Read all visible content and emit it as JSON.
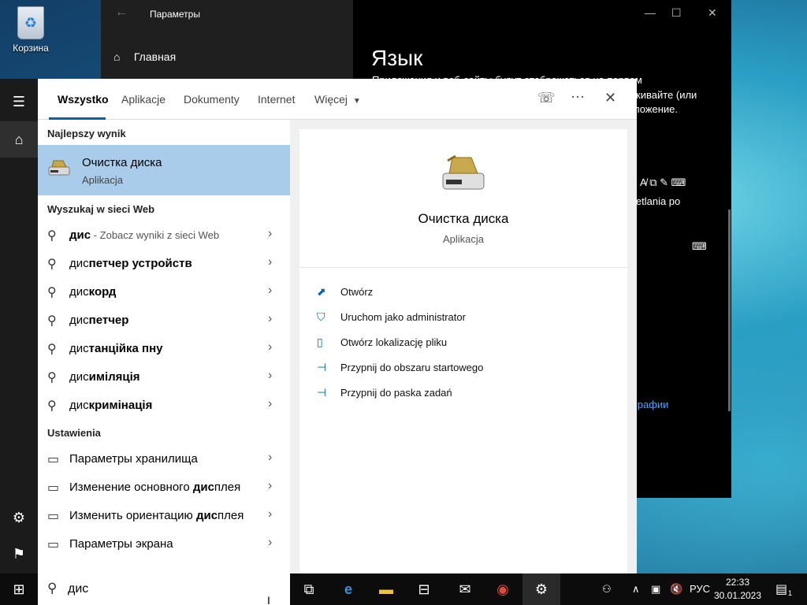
{
  "desktop": {
    "recycle_bin_label": "Корзина"
  },
  "settings_window": {
    "title": "Параметры",
    "home_label": "Главная",
    "heading": "Язык",
    "partial_lines": [
      "Приложения и веб-сайты будут отображаться на первом",
      "живайте (или",
      "ложение."
    ],
    "partial_side": "ietlania po",
    "partial_link": "графии"
  },
  "search": {
    "tabs": [
      {
        "label": "Wszystko",
        "active": true
      },
      {
        "label": "Aplikacje"
      },
      {
        "label": "Dokumenty"
      },
      {
        "label": "Internet"
      },
      {
        "label": "Więcej"
      }
    ],
    "best_match_header": "Najlepszy wynik",
    "best_match": {
      "name": "Очистка диска",
      "type": "Aplikacja"
    },
    "web_header": "Wyszukaj w sieci Web",
    "web_results": [
      {
        "prefix": "дис",
        "rest": "",
        "suffix": " - Zobacz wyniki z sieci Web"
      },
      {
        "prefix": "дис",
        "rest": "петчер устройств",
        "suffix": ""
      },
      {
        "prefix": "дис",
        "rest": "корд",
        "suffix": ""
      },
      {
        "prefix": "дис",
        "rest": "петчер",
        "suffix": ""
      },
      {
        "prefix": "дис",
        "rest": "танційка пну",
        "suffix": ""
      },
      {
        "prefix": "дис",
        "rest": "иміляція",
        "suffix": ""
      },
      {
        "prefix": "дис",
        "rest": "кримінація",
        "suffix": ""
      }
    ],
    "settings_header": "Ustawienia",
    "settings_results": [
      {
        "pre": "Параметры хранилища",
        "bold": "",
        "post": ""
      },
      {
        "pre": "Изменение основного ",
        "bold": "дис",
        "post": "плея"
      },
      {
        "pre": "Изменить ориентацию ",
        "bold": "дис",
        "post": "плея"
      },
      {
        "pre": "Параметры экрана",
        "bold": "",
        "post": ""
      }
    ],
    "preview": {
      "name": "Очистка диска",
      "type": "Aplikacja",
      "actions": [
        "Otwórz",
        "Uruchom jako administrator",
        "Otwórz lokalizację pliku",
        "Przypnij do obszaru startowego",
        "Przypnij do paska zadań"
      ]
    },
    "query": "дис"
  },
  "taskbar": {
    "language": "РУС",
    "time": "22:33",
    "date": "30.01.2023",
    "notification_count": "1"
  }
}
